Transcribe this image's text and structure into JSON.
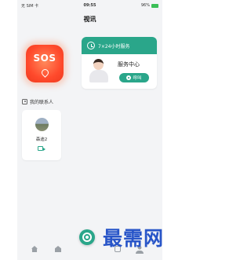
{
  "status_bar": {
    "carrier": "无 SIM 卡 ",
    "time": "09:55",
    "battery": "96%"
  },
  "header": {
    "title": "视讯"
  },
  "sos": {
    "label": "SOS"
  },
  "service_card": {
    "hours": "7×24小时服务",
    "title": "服务中心",
    "call_label": "呼叫"
  },
  "contacts": {
    "header": "我的联系人",
    "items": [
      {
        "name": "森迪2"
      }
    ]
  },
  "watermark": "最需网",
  "colors": {
    "accent": "#2aa68a",
    "sos": "#ff4a2c",
    "watermark": "#2855c8"
  }
}
